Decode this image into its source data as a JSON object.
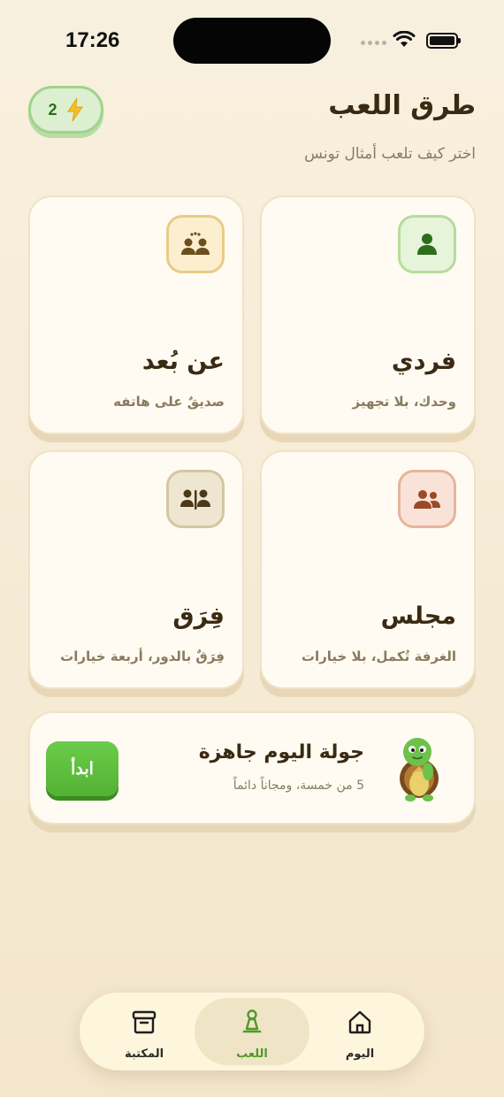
{
  "status_bar": {
    "time": "17:26"
  },
  "header": {
    "title": "طرق اللعب",
    "subtitle": "اختر كيف تلعب أمثال تونس",
    "energy_count": "2"
  },
  "modes": [
    {
      "title": "فردي",
      "description": "وحدك، بلا تجهيز",
      "icon": "single-person-icon",
      "color": "#4f9a2a"
    },
    {
      "title": "عن بُعد",
      "description": "صديقٌ على هاتفه",
      "icon": "remote-friends-icon",
      "color": "#8b6a2a"
    },
    {
      "title": "مجلس",
      "description": "الغرفة تُكمل، بلا خيارات",
      "icon": "group-people-icon",
      "color": "#a5512a"
    },
    {
      "title": "فِرَق",
      "description": "فِرَقٌ بالدور، أربعة خيارات",
      "icon": "teams-icon",
      "color": "#5e4a24"
    }
  ],
  "daily": {
    "title": "جولة اليوم جاهزة",
    "subtitle": "5 من خمسة، ومجاناً دائماً",
    "start_label": "ابدأ"
  },
  "tabs": [
    {
      "label": "المكتبة",
      "icon": "archive-box-icon",
      "active": false
    },
    {
      "label": "اللعب",
      "icon": "game-pawn-icon",
      "active": true
    },
    {
      "label": "اليوم",
      "icon": "home-icon",
      "active": false
    }
  ],
  "colors": {
    "background": "#f8f0df",
    "accent_green": "#52b234",
    "card": "#fffbf2",
    "text_dark": "#3a2a12",
    "text_muted": "#8b7a5f"
  }
}
